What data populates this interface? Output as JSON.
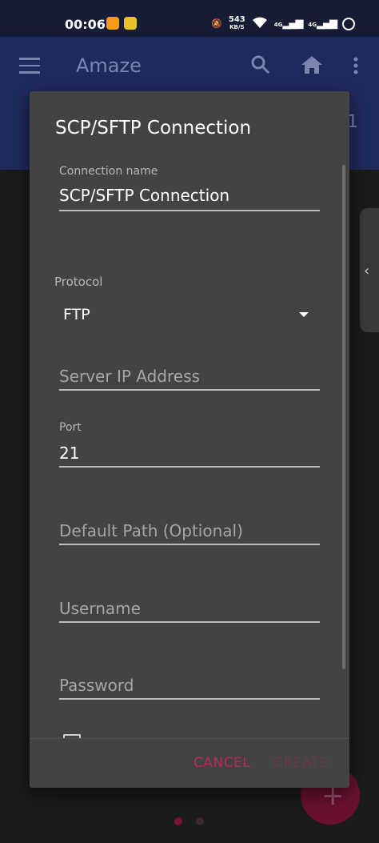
{
  "status_bar": {
    "time": "00:06",
    "net_speed_value": "543",
    "net_speed_unit": "KB/S",
    "sim1_label": "4G",
    "sim2_label": "4G"
  },
  "app_bar": {
    "title": "Amaze",
    "bg_number": "1",
    "icons": [
      "menu-icon",
      "search-icon",
      "home-icon",
      "more-vert-icon"
    ]
  },
  "dialog": {
    "title": "SCP/SFTP Connection",
    "connection_name": {
      "label": "Connection name",
      "value": "SCP/SFTP Connection"
    },
    "protocol": {
      "label": "Protocol",
      "selected": "FTP"
    },
    "server_ip": {
      "placeholder": "Server IP Address"
    },
    "port": {
      "label": "Port",
      "value": "21"
    },
    "default_path": {
      "placeholder": "Default Path (Optional)"
    },
    "username": {
      "placeholder": "Username"
    },
    "password": {
      "placeholder": "Password"
    },
    "buttons": {
      "cancel": "CANCEL",
      "create": "CREATE"
    }
  },
  "colors": {
    "accent": "#c2255c",
    "dialog_bg": "#434343",
    "app_bar_bg": "#1e2a5c"
  }
}
